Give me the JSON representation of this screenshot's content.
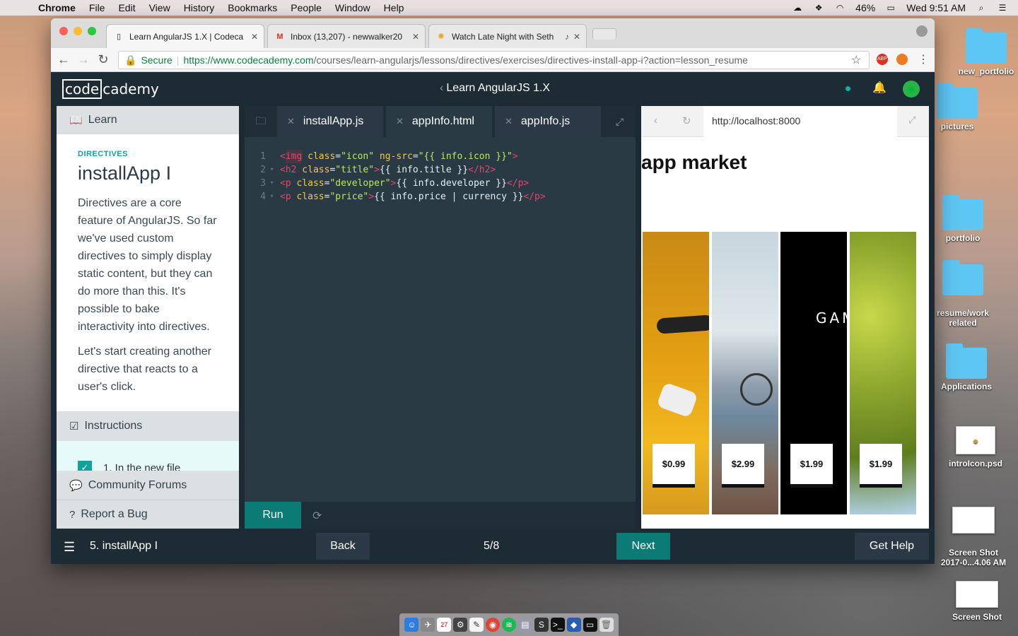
{
  "menubar": {
    "app": "Chrome",
    "items": [
      "File",
      "Edit",
      "View",
      "History",
      "Bookmarks",
      "People",
      "Window",
      "Help"
    ],
    "battery": "46%",
    "clock": "Wed 9:51 AM"
  },
  "desktop": {
    "icons": [
      {
        "label": "new_portfolio"
      },
      {
        "label": "pictures"
      },
      {
        "label": "portfolio"
      },
      {
        "label": "resume/work\nrelated"
      },
      {
        "label": "Applications"
      },
      {
        "label": "introIcon.psd"
      },
      {
        "label": "Screen Shot\n2017-0...4.06 AM"
      },
      {
        "label": "Screen Shot"
      }
    ]
  },
  "browser": {
    "tabs": [
      {
        "title": "Learn AngularJS 1.X | Codeca"
      },
      {
        "title": "Inbox (13,207) - newwalker20"
      },
      {
        "title": "Watch Late Night with Seth"
      }
    ],
    "secure": "Secure",
    "url_host": "https://www.codecademy.com",
    "url_path": "/courses/learn-angularjs/lessons/directives/exercises/directives-install-app-i?action=lesson_resume"
  },
  "codecademy": {
    "logo_a": "code",
    "logo_b": "cademy",
    "course": "Learn AngularJS 1.X",
    "learn": "Learn",
    "kicker": "DIRECTIVES",
    "title": "installApp I",
    "p1": "Directives are a core feature of AngularJS. So far we've used custom directives to simply display static content, but they can do more than this. It's possible to bake interactivity into directives.",
    "p2": "Let's start creating another directive that reacts to a user's click.",
    "instructions": "Instructions",
    "task": "1.  In the new file",
    "forums": "Community Forums",
    "bug": "Report a Bug",
    "editor_tabs": [
      "installApp.js",
      "appInfo.html",
      "appInfo.js"
    ],
    "run": "Run",
    "preview_url": "http://localhost:8000",
    "preview_title": "app market",
    "prices": [
      "$0.99",
      "$2.99",
      "$1.99",
      "$1.99"
    ],
    "gam_text": "GAM",
    "lesson": "5. installApp I",
    "back": "Back",
    "progress": "5/8",
    "next": "Next",
    "help": "Get Help"
  }
}
